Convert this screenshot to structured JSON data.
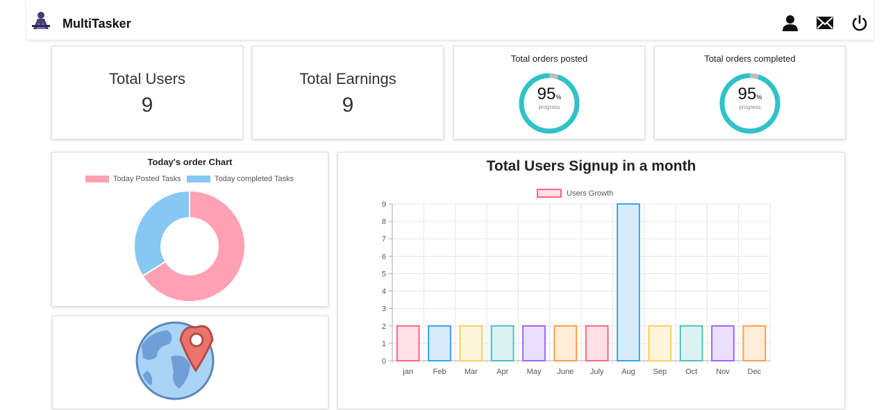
{
  "app": {
    "brand": "MultiTasker"
  },
  "header_icons": [
    "user-icon",
    "mail-icon",
    "power-icon"
  ],
  "stats": [
    {
      "label": "Total Users",
      "value": "9"
    },
    {
      "label": "Total Earnings",
      "value": "9"
    }
  ],
  "progress": [
    {
      "title": "Total orders posted",
      "value": "95",
      "unit": "%",
      "sub": "progress",
      "fraction": 0.95
    },
    {
      "title": "Total orders completed",
      "value": "95",
      "unit": "%",
      "sub": "progress",
      "fraction": 0.95
    }
  ],
  "colors": {
    "ring": "#2ec3c8",
    "ring_track": "#bdbdbd",
    "pink": "#ffa1b5",
    "blue": "#86c7f3"
  },
  "donut": {
    "title": "Today's order Chart",
    "legend": [
      "Today Posted Tasks",
      "Today  completed Tasks"
    ]
  },
  "bar": {
    "title": "Total Users Signup in a month",
    "legend": "Users Growth"
  },
  "chart_data": [
    {
      "type": "pie",
      "title": "Today's order Chart",
      "labels": [
        "Today Posted Tasks",
        "Today  completed Tasks"
      ],
      "values": [
        66,
        34
      ],
      "colors": [
        "#ffa1b5",
        "#86c7f3"
      ],
      "legend": "top"
    },
    {
      "type": "bar",
      "title": "Total Users Signup in a month",
      "categories": [
        "jan",
        "Feb",
        "Mar",
        "Apr",
        "May",
        "June",
        "July",
        "Aug",
        "Sep",
        "Oct",
        "Nov",
        "Dec"
      ],
      "series": [
        {
          "name": "Users Growth",
          "values": [
            2,
            2,
            2,
            2,
            2,
            2,
            2,
            9,
            2,
            2,
            2,
            2
          ]
        }
      ],
      "ylim": [
        0,
        9
      ],
      "yticks": [
        "0",
        "1",
        "2",
        "3",
        "4",
        "5",
        "6",
        "7",
        "8",
        "9"
      ],
      "grid": true,
      "legend": "top",
      "bar_colors": [
        [
          "#ff6384",
          "#ffe0e6"
        ],
        [
          "#36a2eb",
          "#d7ecfb"
        ],
        [
          "#ffce56",
          "#fff5dd"
        ],
        [
          "#4bc0c0",
          "#dbf2f2"
        ],
        [
          "#9966ff",
          "#ebe0ff"
        ],
        [
          "#ff9f40",
          "#ffecd9"
        ],
        [
          "#ff6384",
          "#ffe0e6"
        ],
        [
          "#36a2eb",
          "#d7ecfb"
        ],
        [
          "#ffce56",
          "#fff5dd"
        ],
        [
          "#4bc0c0",
          "#dbf2f2"
        ],
        [
          "#9966ff",
          "#ebe0ff"
        ],
        [
          "#ff9f40",
          "#ffecd9"
        ]
      ]
    }
  ]
}
